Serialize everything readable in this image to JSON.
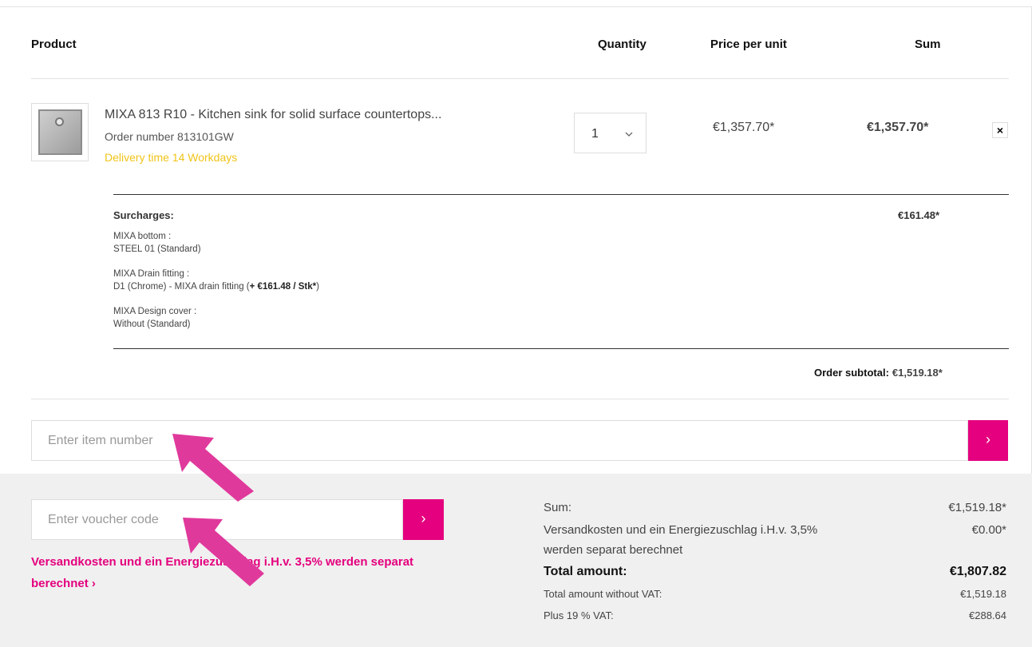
{
  "table": {
    "headers": {
      "product": "Product",
      "quantity": "Quantity",
      "price_per_unit": "Price per unit",
      "sum": "Sum"
    }
  },
  "item": {
    "name": "MIXA 813 R10 - Kitchen sink for solid surface countertops...",
    "order_number": "Order number 813101GW",
    "delivery": "Delivery time 14 Workdays",
    "quantity": "1",
    "price_per_unit": "€1,357.70*",
    "sum": "€1,357.70*",
    "remove_symbol": "×"
  },
  "surcharges": {
    "title": "Surcharges:",
    "price": "€161.48*",
    "options": [
      {
        "label": "MIXA bottom :",
        "value": "STEEL 01 (Standard)"
      },
      {
        "label": "MIXA Drain fitting :",
        "value": "D1 (Chrome) - MIXA drain fitting (",
        "extra": "+ €161.48 / Stk*",
        "suffix": ")"
      },
      {
        "label": "MIXA Design cover :",
        "value": "Without (Standard)"
      }
    ]
  },
  "subtotal": {
    "label": "Order subtotal:",
    "value": "€1,519.18*"
  },
  "item_number": {
    "placeholder": "Enter item number",
    "button": "›"
  },
  "voucher": {
    "placeholder": "Enter voucher code",
    "button": "›"
  },
  "shipping_note": {
    "text": "Versandkosten und ein Energiezuschlag i.H.v. 3,5% werden separat berechnet",
    "chevron": "›"
  },
  "summary": {
    "sum_label": "Sum:",
    "sum_value": "€1,519.18*",
    "shipping_label_1": "Versandkosten und ein Energiezuschlag i.H.v. 3,5%",
    "shipping_label_2": "werden separat berechnet",
    "shipping_value": "€0.00*",
    "total_label": "Total amount:",
    "total_value": "€1,807.82",
    "net_label": "Total amount without VAT:",
    "net_value": "€1,519.18",
    "vat_label": "Plus 19 % VAT:",
    "vat_value": "€288.64"
  },
  "colors": {
    "accent": "#e4007e",
    "delivery": "#f0c419",
    "annotation_arrow": "#e0399c"
  }
}
